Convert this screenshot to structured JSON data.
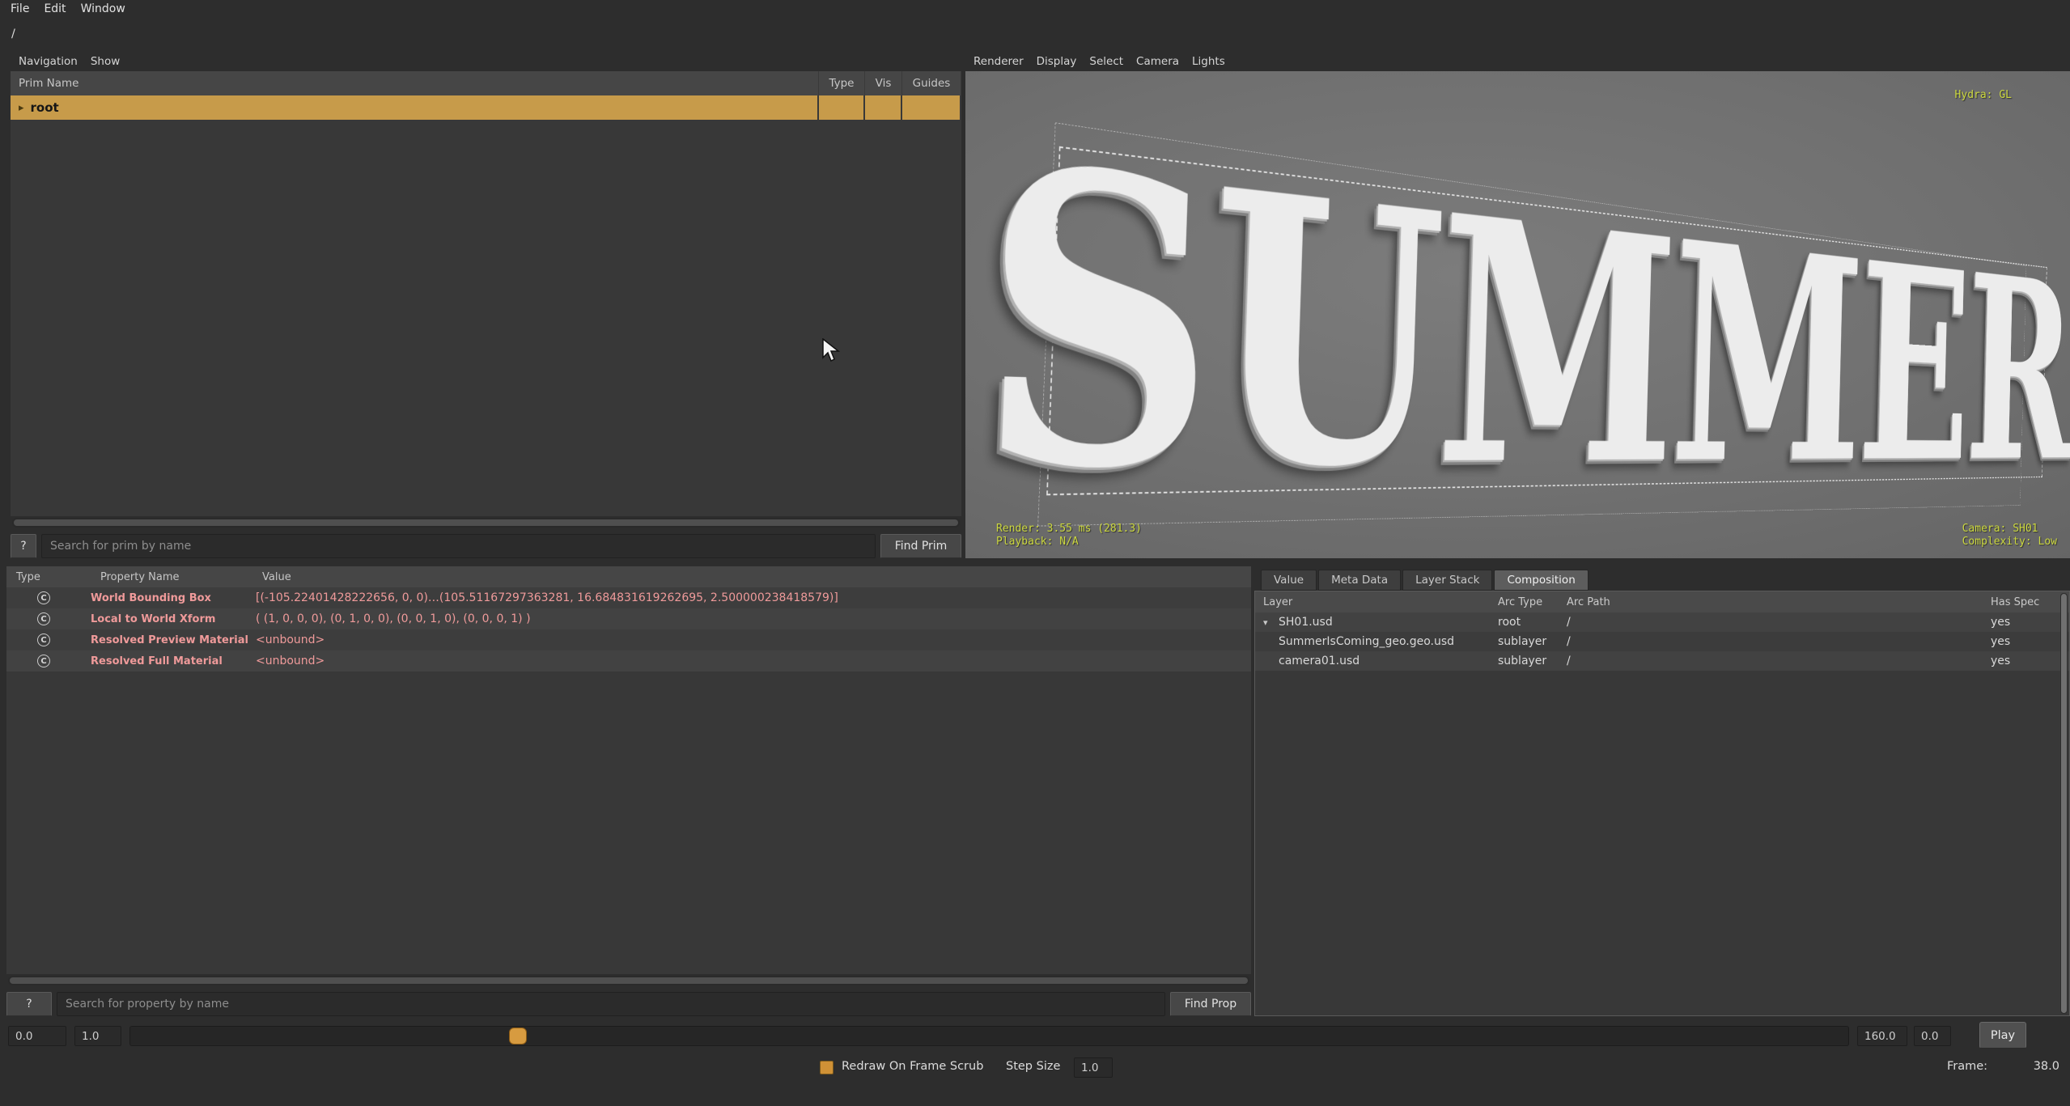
{
  "menubar": {
    "items": [
      "File",
      "Edit",
      "Window"
    ]
  },
  "pathbar": {
    "value": "/"
  },
  "browser": {
    "menus": [
      "Navigation",
      "Show"
    ],
    "columns": [
      "Prim Name",
      "Type",
      "Vis",
      "Guides"
    ],
    "root_row": {
      "expander": "▸",
      "label": "root"
    },
    "help_label": "?",
    "search_placeholder": "Search for prim by name",
    "find_label": "Find Prim"
  },
  "viewport": {
    "menus": [
      "Renderer",
      "Display",
      "Select",
      "Camera",
      "Lights"
    ],
    "scene_text": "SUMMER",
    "hud": {
      "hydra": "Hydra: GL",
      "render": "Render: 3.55 ms (281.3)",
      "playback": "Playback: N/A",
      "camera": "Camera: SH01",
      "complexity": "Complexity: Low"
    }
  },
  "properties": {
    "columns": [
      "Type",
      "Property Name",
      "Value"
    ],
    "rows": [
      {
        "icon": "C",
        "name": "World Bounding Box",
        "value": "[(-105.22401428222656, 0, 0)…(105.51167297363281, 16.684831619262695, 2.500000238418579)]"
      },
      {
        "icon": "C",
        "name": "Local to World Xform",
        "value": "( (1, 0, 0, 0), (0, 1, 0, 0), (0, 0, 1, 0), (0, 0, 0, 1) )"
      },
      {
        "icon": "C",
        "name": "Resolved Preview Material",
        "value": "<unbound>"
      },
      {
        "icon": "C",
        "name": "Resolved Full Material",
        "value": "<unbound>"
      }
    ],
    "help_label": "?",
    "search_placeholder": "Search for property by name",
    "find_label": "Find Prop"
  },
  "inspector": {
    "tabs": [
      "Value",
      "Meta Data",
      "Layer Stack",
      "Composition"
    ],
    "active_tab": "Composition",
    "columns": [
      "Layer",
      "Arc Type",
      "Arc Path",
      "Has Spec"
    ],
    "rows": [
      {
        "expander": "▾",
        "layer": "SH01.usd",
        "arc_type": "root",
        "arc_path": "/",
        "has_spec": "yes"
      },
      {
        "expander": "",
        "layer": "SummerIsComing_geo.geo.usd",
        "arc_type": "sublayer",
        "arc_path": "/",
        "has_spec": "yes"
      },
      {
        "expander": "",
        "layer": "camera01.usd",
        "arc_type": "sublayer",
        "arc_path": "/",
        "has_spec": "yes"
      }
    ]
  },
  "timeline": {
    "range_start": "0.0",
    "range_step": "1.0",
    "range_end": "160.0",
    "range_end2": "0.0",
    "play_label": "Play"
  },
  "controls": {
    "redraw_label": "Redraw On Frame Scrub",
    "step_size_label": "Step Size",
    "step_size_value": "1.0",
    "frame_label": "Frame:",
    "frame_value": "38.0"
  }
}
